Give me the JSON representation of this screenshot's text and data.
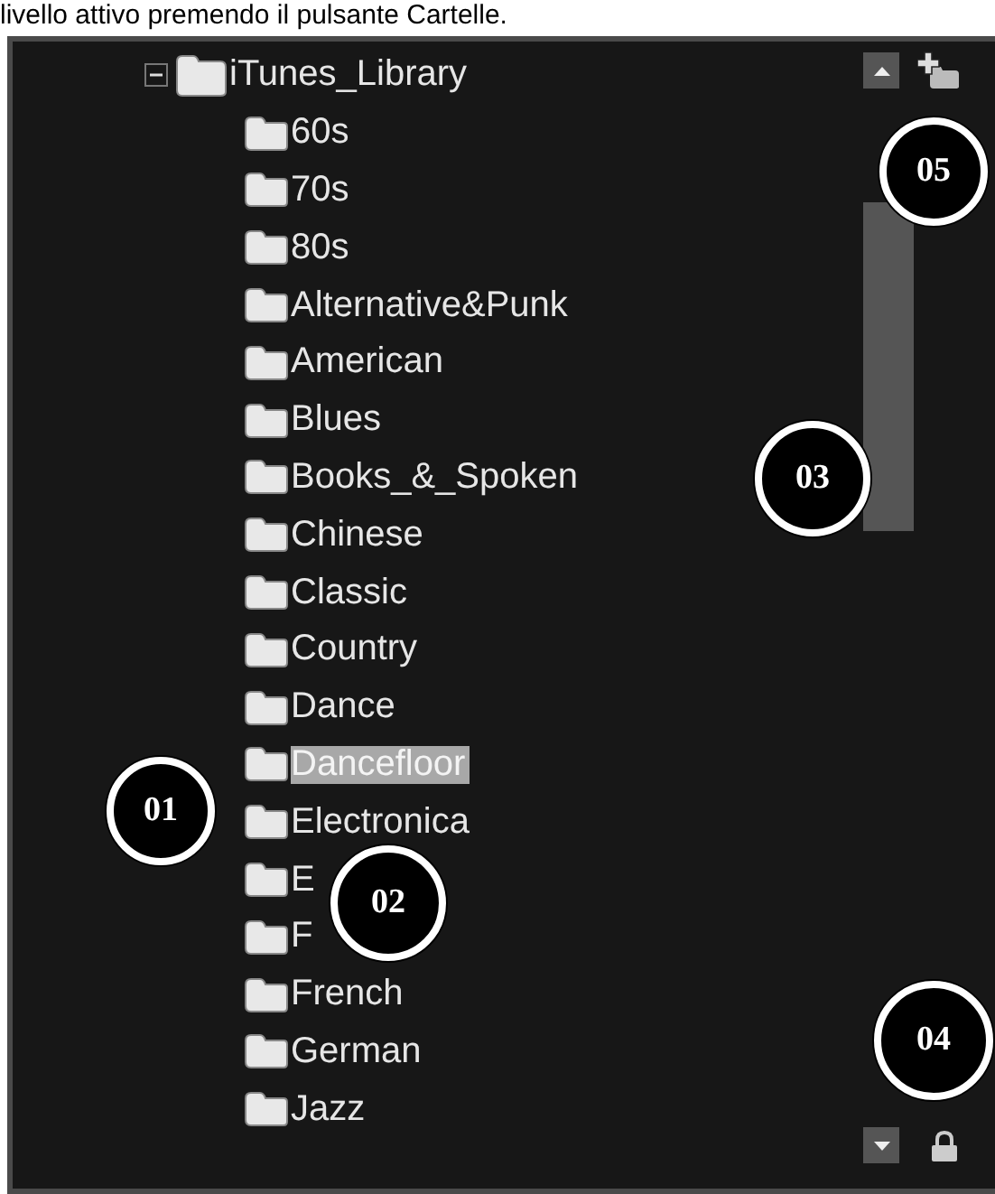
{
  "caption": "livello attivo premendo il pulsante Cartelle.",
  "tree": {
    "label": "iTunes_Library",
    "expanded": true,
    "selected": false,
    "children": [
      {
        "label": "60s",
        "selected": false
      },
      {
        "label": "70s",
        "selected": false
      },
      {
        "label": "80s",
        "selected": false
      },
      {
        "label": "Alternative&Punk",
        "selected": false
      },
      {
        "label": "American",
        "selected": false
      },
      {
        "label": "Blues",
        "selected": false
      },
      {
        "label": "Books_&_Spoken",
        "selected": false
      },
      {
        "label": "Chinese",
        "selected": false
      },
      {
        "label": "Classic",
        "selected": false
      },
      {
        "label": "Country",
        "selected": false
      },
      {
        "label": "Dance",
        "selected": false
      },
      {
        "label": "Dancefloor",
        "selected": true
      },
      {
        "label": "Electronica",
        "selected": false
      },
      {
        "label": "E",
        "selected": false
      },
      {
        "label": "F",
        "selected": false
      },
      {
        "label": "French",
        "selected": false
      },
      {
        "label": "German",
        "selected": false
      },
      {
        "label": "Jazz",
        "selected": false
      }
    ]
  },
  "callouts": [
    {
      "label": "01"
    },
    {
      "label": "02"
    },
    {
      "label": "03"
    },
    {
      "label": "04"
    },
    {
      "label": "05"
    }
  ]
}
